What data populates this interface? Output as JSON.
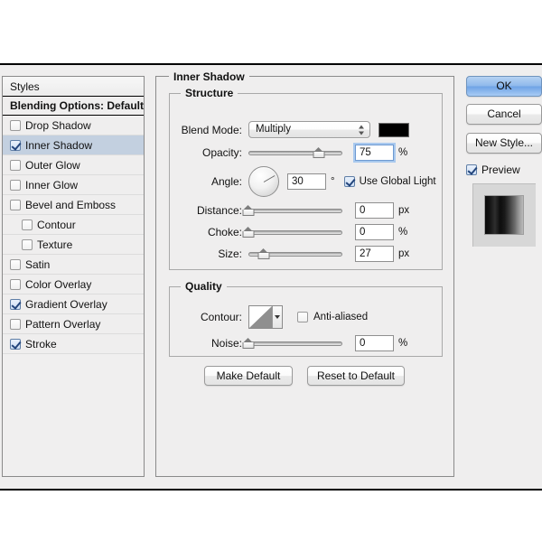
{
  "sidebar": {
    "header": "Styles",
    "blending_options": "Blending Options: Default",
    "items": [
      {
        "label": "Drop Shadow",
        "checked": false,
        "indent": false,
        "selected": false
      },
      {
        "label": "Inner Shadow",
        "checked": true,
        "indent": false,
        "selected": true
      },
      {
        "label": "Outer Glow",
        "checked": false,
        "indent": false,
        "selected": false
      },
      {
        "label": "Inner Glow",
        "checked": false,
        "indent": false,
        "selected": false
      },
      {
        "label": "Bevel and Emboss",
        "checked": false,
        "indent": false,
        "selected": false
      },
      {
        "label": "Contour",
        "checked": false,
        "indent": true,
        "selected": false
      },
      {
        "label": "Texture",
        "checked": false,
        "indent": true,
        "selected": false
      },
      {
        "label": "Satin",
        "checked": false,
        "indent": false,
        "selected": false
      },
      {
        "label": "Color Overlay",
        "checked": false,
        "indent": false,
        "selected": false
      },
      {
        "label": "Gradient Overlay",
        "checked": true,
        "indent": false,
        "selected": false
      },
      {
        "label": "Pattern Overlay",
        "checked": false,
        "indent": false,
        "selected": false
      },
      {
        "label": "Stroke",
        "checked": true,
        "indent": false,
        "selected": false
      }
    ]
  },
  "main": {
    "title": "Inner Shadow",
    "structure": {
      "title": "Structure",
      "blend_mode_label": "Blend Mode:",
      "blend_mode_value": "Multiply",
      "shadow_color": "#000000",
      "opacity_label": "Opacity:",
      "opacity_value": "75",
      "opacity_unit": "%",
      "opacity_percent": 75,
      "angle_label": "Angle:",
      "angle_value": "30",
      "angle_unit": "°",
      "angle_degrees": 30,
      "use_global_light_label": "Use Global Light",
      "use_global_light_checked": true,
      "distance_label": "Distance:",
      "distance_value": "0",
      "distance_unit": "px",
      "distance_percent": 0,
      "choke_label": "Choke:",
      "choke_value": "0",
      "choke_unit": "%",
      "choke_percent": 0,
      "size_label": "Size:",
      "size_value": "27",
      "size_unit": "px",
      "size_percent": 16
    },
    "quality": {
      "title": "Quality",
      "contour_label": "Contour:",
      "anti_aliased_label": "Anti-aliased",
      "anti_aliased_checked": false,
      "noise_label": "Noise:",
      "noise_value": "0",
      "noise_unit": "%",
      "noise_percent": 0
    },
    "make_default_label": "Make Default",
    "reset_to_default_label": "Reset to Default"
  },
  "right": {
    "ok_label": "OK",
    "cancel_label": "Cancel",
    "new_style_label": "New Style...",
    "preview_label": "Preview",
    "preview_checked": true
  },
  "colors": {
    "dialog_bg": "#efeeee",
    "selection": "#c3d0e0",
    "default_button": "#8fb9ec",
    "focus_ring": "#a9c9ee",
    "swatch": "#000000"
  }
}
